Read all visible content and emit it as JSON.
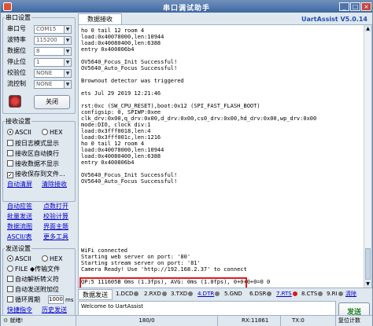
{
  "window": {
    "title": "串口调试助手",
    "minimize": "_",
    "maximize": "□",
    "close": "×"
  },
  "serial_settings": {
    "legend": "串口设置",
    "rows": [
      {
        "label": "串口号",
        "value": "COM15"
      },
      {
        "label": "波特率",
        "value": "115200"
      },
      {
        "label": "数据位",
        "value": "8"
      },
      {
        "label": "停止位",
        "value": "1"
      },
      {
        "label": "校验位",
        "value": "NONE"
      },
      {
        "label": "流控制",
        "value": "NONE"
      }
    ],
    "close_button": "关闭"
  },
  "recv_settings": {
    "legend": "接收设置",
    "ascii": "ASCII",
    "hex": "HEX",
    "options": [
      "按日志模式显示",
      "接收区自动换行",
      "接收数据不显示",
      "接收保存到文件..."
    ],
    "auto_clear": "自动清屏",
    "clear_recv": "清除接收"
  },
  "tools": [
    "自动应答",
    "点数打开",
    "批量发送",
    "校验计算",
    "数据流图",
    "界面主题",
    "ASCII/表",
    "更多工具"
  ],
  "send_settings": {
    "legend": "发送设置",
    "ascii": "ASCII",
    "hex": "HEX",
    "options": [
      "FILE ◆传输文件",
      "自动解析转义符",
      "自动发送附加位",
      "循环周期"
    ],
    "period": "1000",
    "period_unit": "ms",
    "quick_cmd": "快捷指令",
    "history": "历史发送"
  },
  "recv": {
    "tab": "数据接收",
    "brand": "UartAssist V5.0.14",
    "lines": [
      "ho 0 tail 12 room 4",
      "load:0x40078000,len:10944",
      "load:0x40080400,len:6388",
      "entry 0x400806b4",
      "",
      "OV5640_Focus_Init Successful!",
      "OV5640_Auto_Focus Successful!",
      "",
      "Brownout detector was triggered",
      "",
      "ets Jul 29 2019 12:21:46",
      "",
      "rst:0xc (SW_CPU_RESET),boot:0x12 (SPI_FAST_FLASH_BOOT)",
      "configsip: 0, SPIWP:0xee",
      "clk_drv:0x00,q_drv:0x00,d_drv:0x00,cs0_drv:0x00,hd_drv:0x00,wp_drv:0x00",
      "mode:DIO, clock div:1",
      "load:0x3fff0018,len:4",
      "load:0x3fff001c,len:1216",
      "ho 0 tail 12 room 4",
      "load:0x40078000,len:10944",
      "load:0x40080400,len:6388",
      "entry 0x400806b4",
      "",
      "OV5640_Focus_Init Successful!",
      "OV5640_Auto_Focus Successful!",
      "",
      "",
      "",
      "",
      "",
      "",
      "",
      "",
      "",
      "",
      "WiFi connected",
      "Starting web server on port: '80'",
      "Starting stream server on port: '81'",
      "Camera Ready! Use 'http://192.168.2.37' to connect",
      "",
      "QP:5 111605B 0ms (1.3fps), AVG: 0ms (1.0fps), 0+0+0+0=0 0"
    ]
  },
  "signals": {
    "send_tab": "数据发送",
    "items": [
      "1.DCD",
      "2.RXD",
      "3.TXD",
      "4.DTR",
      "5.GND",
      "6.DSR",
      "7.RTS",
      "8.CTS",
      "9.RI"
    ],
    "clear_btn": "清除",
    "clear2_btn": "清除"
  },
  "send": {
    "text": "Welcome to UartAssist",
    "button": "发送"
  },
  "status": {
    "ready": "就绪!",
    "lines": "180/0",
    "rx": "RX:11861",
    "tx": "TX:0",
    "reset": "复位计数"
  }
}
